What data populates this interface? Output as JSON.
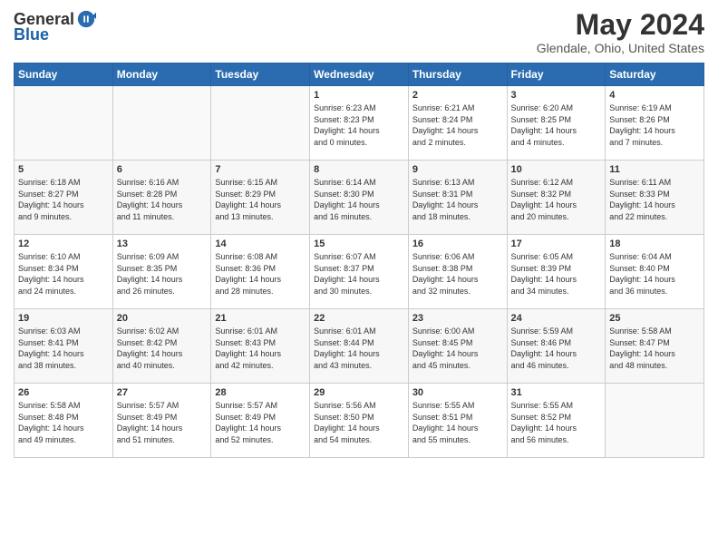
{
  "header": {
    "logo_general": "General",
    "logo_blue": "Blue",
    "title": "May 2024",
    "subtitle": "Glendale, Ohio, United States"
  },
  "days_of_week": [
    "Sunday",
    "Monday",
    "Tuesday",
    "Wednesday",
    "Thursday",
    "Friday",
    "Saturday"
  ],
  "weeks": [
    [
      {
        "day": "",
        "info": ""
      },
      {
        "day": "",
        "info": ""
      },
      {
        "day": "",
        "info": ""
      },
      {
        "day": "1",
        "info": "Sunrise: 6:23 AM\nSunset: 8:23 PM\nDaylight: 14 hours\nand 0 minutes."
      },
      {
        "day": "2",
        "info": "Sunrise: 6:21 AM\nSunset: 8:24 PM\nDaylight: 14 hours\nand 2 minutes."
      },
      {
        "day": "3",
        "info": "Sunrise: 6:20 AM\nSunset: 8:25 PM\nDaylight: 14 hours\nand 4 minutes."
      },
      {
        "day": "4",
        "info": "Sunrise: 6:19 AM\nSunset: 8:26 PM\nDaylight: 14 hours\nand 7 minutes."
      }
    ],
    [
      {
        "day": "5",
        "info": "Sunrise: 6:18 AM\nSunset: 8:27 PM\nDaylight: 14 hours\nand 9 minutes."
      },
      {
        "day": "6",
        "info": "Sunrise: 6:16 AM\nSunset: 8:28 PM\nDaylight: 14 hours\nand 11 minutes."
      },
      {
        "day": "7",
        "info": "Sunrise: 6:15 AM\nSunset: 8:29 PM\nDaylight: 14 hours\nand 13 minutes."
      },
      {
        "day": "8",
        "info": "Sunrise: 6:14 AM\nSunset: 8:30 PM\nDaylight: 14 hours\nand 16 minutes."
      },
      {
        "day": "9",
        "info": "Sunrise: 6:13 AM\nSunset: 8:31 PM\nDaylight: 14 hours\nand 18 minutes."
      },
      {
        "day": "10",
        "info": "Sunrise: 6:12 AM\nSunset: 8:32 PM\nDaylight: 14 hours\nand 20 minutes."
      },
      {
        "day": "11",
        "info": "Sunrise: 6:11 AM\nSunset: 8:33 PM\nDaylight: 14 hours\nand 22 minutes."
      }
    ],
    [
      {
        "day": "12",
        "info": "Sunrise: 6:10 AM\nSunset: 8:34 PM\nDaylight: 14 hours\nand 24 minutes."
      },
      {
        "day": "13",
        "info": "Sunrise: 6:09 AM\nSunset: 8:35 PM\nDaylight: 14 hours\nand 26 minutes."
      },
      {
        "day": "14",
        "info": "Sunrise: 6:08 AM\nSunset: 8:36 PM\nDaylight: 14 hours\nand 28 minutes."
      },
      {
        "day": "15",
        "info": "Sunrise: 6:07 AM\nSunset: 8:37 PM\nDaylight: 14 hours\nand 30 minutes."
      },
      {
        "day": "16",
        "info": "Sunrise: 6:06 AM\nSunset: 8:38 PM\nDaylight: 14 hours\nand 32 minutes."
      },
      {
        "day": "17",
        "info": "Sunrise: 6:05 AM\nSunset: 8:39 PM\nDaylight: 14 hours\nand 34 minutes."
      },
      {
        "day": "18",
        "info": "Sunrise: 6:04 AM\nSunset: 8:40 PM\nDaylight: 14 hours\nand 36 minutes."
      }
    ],
    [
      {
        "day": "19",
        "info": "Sunrise: 6:03 AM\nSunset: 8:41 PM\nDaylight: 14 hours\nand 38 minutes."
      },
      {
        "day": "20",
        "info": "Sunrise: 6:02 AM\nSunset: 8:42 PM\nDaylight: 14 hours\nand 40 minutes."
      },
      {
        "day": "21",
        "info": "Sunrise: 6:01 AM\nSunset: 8:43 PM\nDaylight: 14 hours\nand 42 minutes."
      },
      {
        "day": "22",
        "info": "Sunrise: 6:01 AM\nSunset: 8:44 PM\nDaylight: 14 hours\nand 43 minutes."
      },
      {
        "day": "23",
        "info": "Sunrise: 6:00 AM\nSunset: 8:45 PM\nDaylight: 14 hours\nand 45 minutes."
      },
      {
        "day": "24",
        "info": "Sunrise: 5:59 AM\nSunset: 8:46 PM\nDaylight: 14 hours\nand 46 minutes."
      },
      {
        "day": "25",
        "info": "Sunrise: 5:58 AM\nSunset: 8:47 PM\nDaylight: 14 hours\nand 48 minutes."
      }
    ],
    [
      {
        "day": "26",
        "info": "Sunrise: 5:58 AM\nSunset: 8:48 PM\nDaylight: 14 hours\nand 49 minutes."
      },
      {
        "day": "27",
        "info": "Sunrise: 5:57 AM\nSunset: 8:49 PM\nDaylight: 14 hours\nand 51 minutes."
      },
      {
        "day": "28",
        "info": "Sunrise: 5:57 AM\nSunset: 8:49 PM\nDaylight: 14 hours\nand 52 minutes."
      },
      {
        "day": "29",
        "info": "Sunrise: 5:56 AM\nSunset: 8:50 PM\nDaylight: 14 hours\nand 54 minutes."
      },
      {
        "day": "30",
        "info": "Sunrise: 5:55 AM\nSunset: 8:51 PM\nDaylight: 14 hours\nand 55 minutes."
      },
      {
        "day": "31",
        "info": "Sunrise: 5:55 AM\nSunset: 8:52 PM\nDaylight: 14 hours\nand 56 minutes."
      },
      {
        "day": "",
        "info": ""
      }
    ]
  ]
}
